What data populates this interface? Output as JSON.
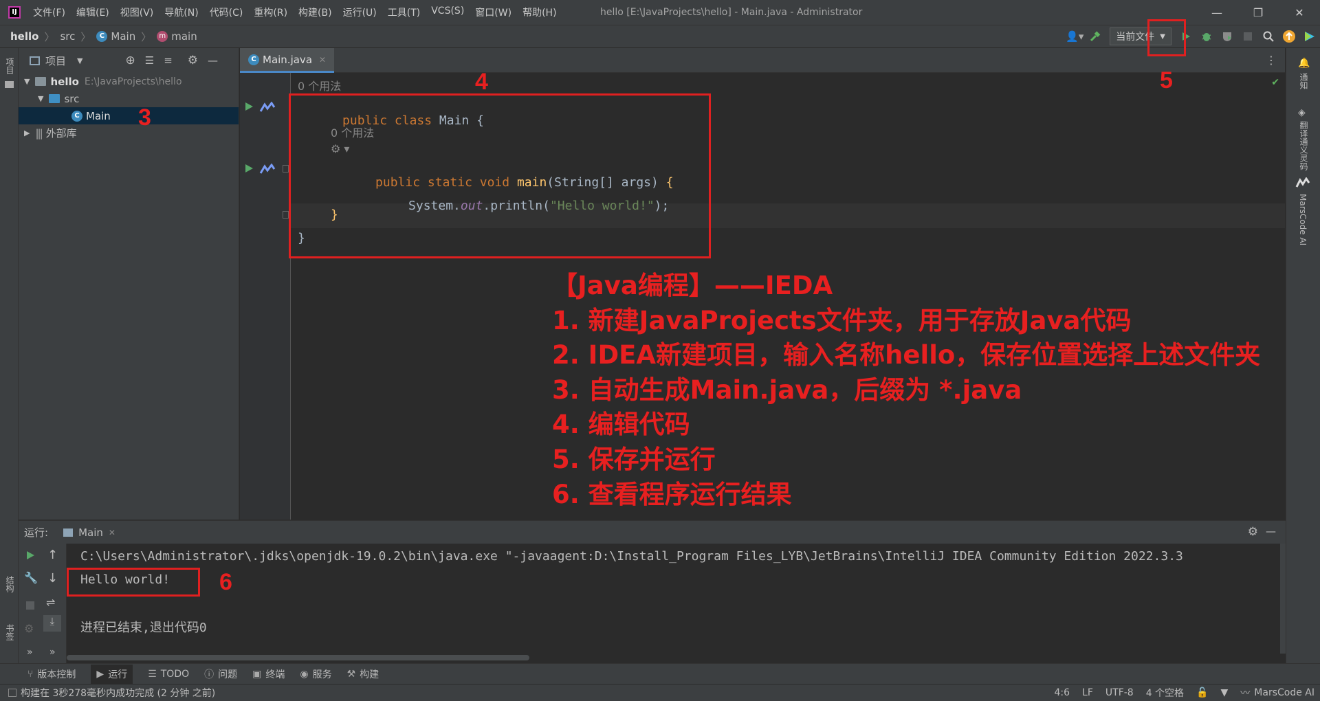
{
  "window": {
    "title": "hello [E:\\JavaProjects\\hello] - Main.java - Administrator",
    "menu": [
      "文件(F)",
      "编辑(E)",
      "视图(V)",
      "导航(N)",
      "代码(C)",
      "重构(R)",
      "构建(B)",
      "运行(U)",
      "工具(T)",
      "VCS(S)",
      "窗口(W)",
      "帮助(H)"
    ]
  },
  "breadcrumb": {
    "project": "hello",
    "folder": "src",
    "class": "Main",
    "method": "main"
  },
  "toolbar": {
    "run_config": "当前文件"
  },
  "project_panel": {
    "title": "项目",
    "tree": [
      {
        "label": "hello",
        "path": "E:\\JavaProjects\\hello"
      },
      {
        "label": "src"
      },
      {
        "label": "Main"
      },
      {
        "label": "外部库"
      }
    ]
  },
  "editor": {
    "tab": "Main.java",
    "usage_hint_class": "0 个用法",
    "usage_hint_method": "0 个用法",
    "code": {
      "l1_kw": "public class ",
      "l1_name": "Main",
      "l1_brace": " {",
      "l2_kw": "public static void ",
      "l2_fn": "main",
      "l2_params": "(String[] args) ",
      "l2_brace": "{",
      "l3_a": "System.",
      "l3_out": "out",
      "l3_b": ".println(",
      "l3_str": "\"Hello world!\"",
      "l3_c": ");",
      "l4": "}",
      "l5": "}"
    }
  },
  "annotations": {
    "numbers": [
      "3",
      "4",
      "5",
      "6"
    ],
    "lines": [
      "【Java编程】——IEDA",
      "1. 新建JavaProjects文件夹，用于存放Java代码",
      "2. IDEA新建项目，输入名称hello，保存位置选择上述文件夹",
      "3. 自动生成Main.java，后缀为 *.java",
      "4. 编辑代码",
      "5. 保存并运行",
      "6. 查看程序运行结果"
    ],
    "color": "#e82020"
  },
  "run_panel": {
    "label": "运行:",
    "tab": "Main",
    "console": [
      "C:\\Users\\Administrator\\.jdks\\openjdk-19.0.2\\bin\\java.exe \"-javaagent:D:\\Install_Program Files_LYB\\JetBrains\\IntelliJ IDEA Community Edition 2022.3.3",
      "Hello world!",
      "",
      "进程已结束,退出代码0"
    ]
  },
  "left_strip": {
    "project_tab": "项目",
    "structure_tab": "结构",
    "bookmarks_tab": "书签"
  },
  "right_strip": {
    "notifications": "通知",
    "translate": "翻译通义灵码",
    "marscode": "MarsCode AI"
  },
  "bottom_tools": [
    "版本控制",
    "运行",
    "TODO",
    "问题",
    "终端",
    "服务",
    "构建"
  ],
  "status": {
    "message": "构建在 3秒278毫秒内成功完成 (2 分钟 之前)",
    "position": "4:6",
    "line_sep": "LF",
    "encoding": "UTF-8",
    "indent": "4 个空格",
    "plugin": "MarsCode AI"
  },
  "colors": {
    "bg": "#2b2b2b",
    "panel": "#3c3f41",
    "keyword": "#cc7832",
    "string": "#6a8759",
    "function": "#ffc66d",
    "accent": "#4a88c7"
  }
}
